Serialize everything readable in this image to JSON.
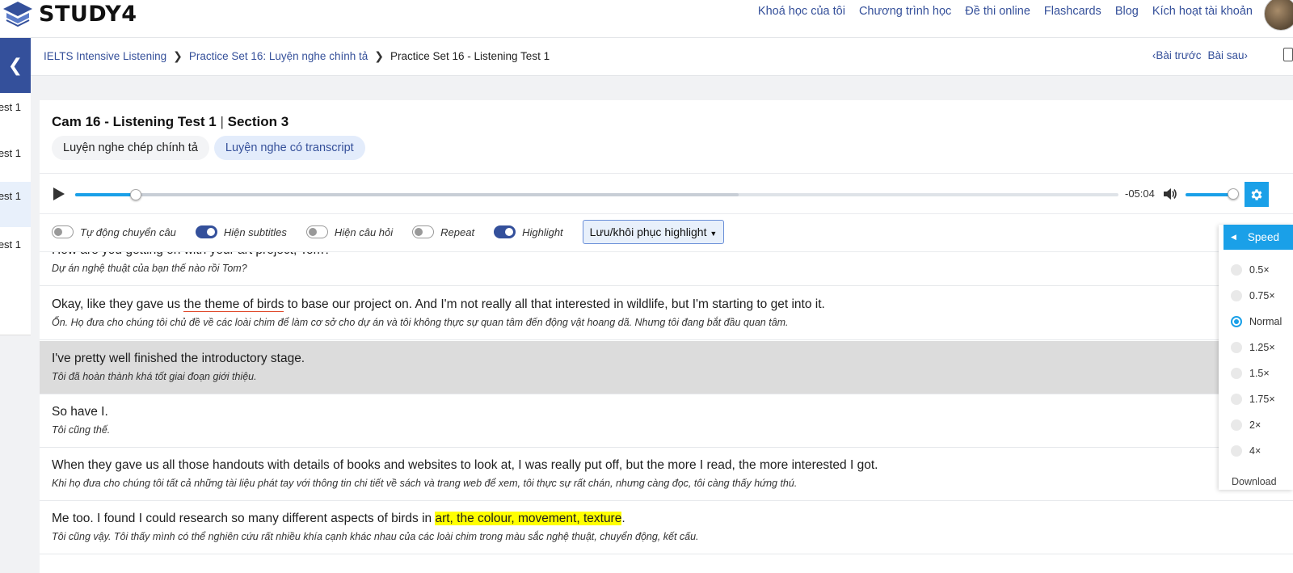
{
  "brand": {
    "name": "STUDY4"
  },
  "nav": [
    "Khoá học của tôi",
    "Chương trình học",
    "Đề thi online",
    "Flashcards",
    "Blog",
    "Kích hoạt tài khoản"
  ],
  "breadcrumb": [
    "IELTS Intensive Listening",
    "Practice Set 16: Luyện nghe chính tả",
    "Practice Set 16 - Listening Test 1"
  ],
  "pager": {
    "prev": "Bài trước",
    "next": "Bài sau"
  },
  "sidebar": [
    "est 1",
    "est 1",
    "est 1",
    "est 1"
  ],
  "lesson": {
    "title": "Cam 16 - Listening Test 1",
    "title_sep": "|",
    "section": "Section 3",
    "tabs": [
      "Luyện nghe chép chính tả",
      "Luyện nghe có transcript"
    ]
  },
  "player": {
    "time": "-05:04",
    "progress": 0.058,
    "buffered": 0.636,
    "volume": 1.0
  },
  "options": {
    "toggles": [
      {
        "label": "Tự động chuyển câu",
        "on": false
      },
      {
        "label": "Hiện subtitles",
        "on": true
      },
      {
        "label": "Hiện câu hỏi",
        "on": false
      },
      {
        "label": "Repeat",
        "on": false
      },
      {
        "label": "Highlight",
        "on": true
      }
    ],
    "highlight_button": "Lưu/khôi phục highlight"
  },
  "transcript": [
    {
      "en": "How are you getting on with your art project, Tom?",
      "vi": "Dự án nghệ thuật của bạn thế nào rồi Tom?"
    },
    {
      "en_pre": "Okay, like they gave us ",
      "en_mark": "the theme of birds",
      "en_post": " to base our project on. And I'm not really all that interested in wildlife, but I'm starting to get into it.",
      "vi": "Ổn. Họ đưa cho chúng tôi chủ đề về các loài chim để làm cơ sở cho dự án và tôi không thực sự quan tâm đến động vật hoang dã. Nhưng tôi đang bắt đầu quan tâm."
    },
    {
      "en": "I've pretty well finished the introductory stage.",
      "vi": "Tôi đã hoàn thành khá tốt giai đoạn giới thiệu."
    },
    {
      "en": "So have I.",
      "vi": "Tôi cũng thế."
    },
    {
      "en": "When they gave us all those handouts with details of books and websites to look at, I was really put off, but the more I read, the more interested I got.",
      "vi": "Khi họ đưa cho chúng tôi tất cả những tài liệu phát tay với thông tin chi tiết về sách và trang web để xem, tôi thực sự rất chán, nhưng càng đọc, tôi càng thấy hứng thú."
    },
    {
      "en_pre": "Me too. I found I could research so many different aspects of birds in ",
      "en_mark": "art, the colour, movement, texture",
      "en_post": ".",
      "vi": "Tôi cũng vậy. Tôi thấy mình có thể nghiên cứu rất nhiều khía cạnh khác nhau của các loài chim trong màu sắc nghệ thuật, chuyển động, kết cấu."
    }
  ],
  "speed_menu": {
    "title": "Speed",
    "options": [
      "0.5×",
      "0.75×",
      "Normal",
      "1.25×",
      "1.5×",
      "1.75×",
      "2×",
      "4×"
    ],
    "selected": "Normal",
    "download": "Download"
  },
  "colors": {
    "primary": "#34509b",
    "accent": "#1aa0e8",
    "highlight": "#ffff00",
    "underline": "#e04a2c"
  }
}
